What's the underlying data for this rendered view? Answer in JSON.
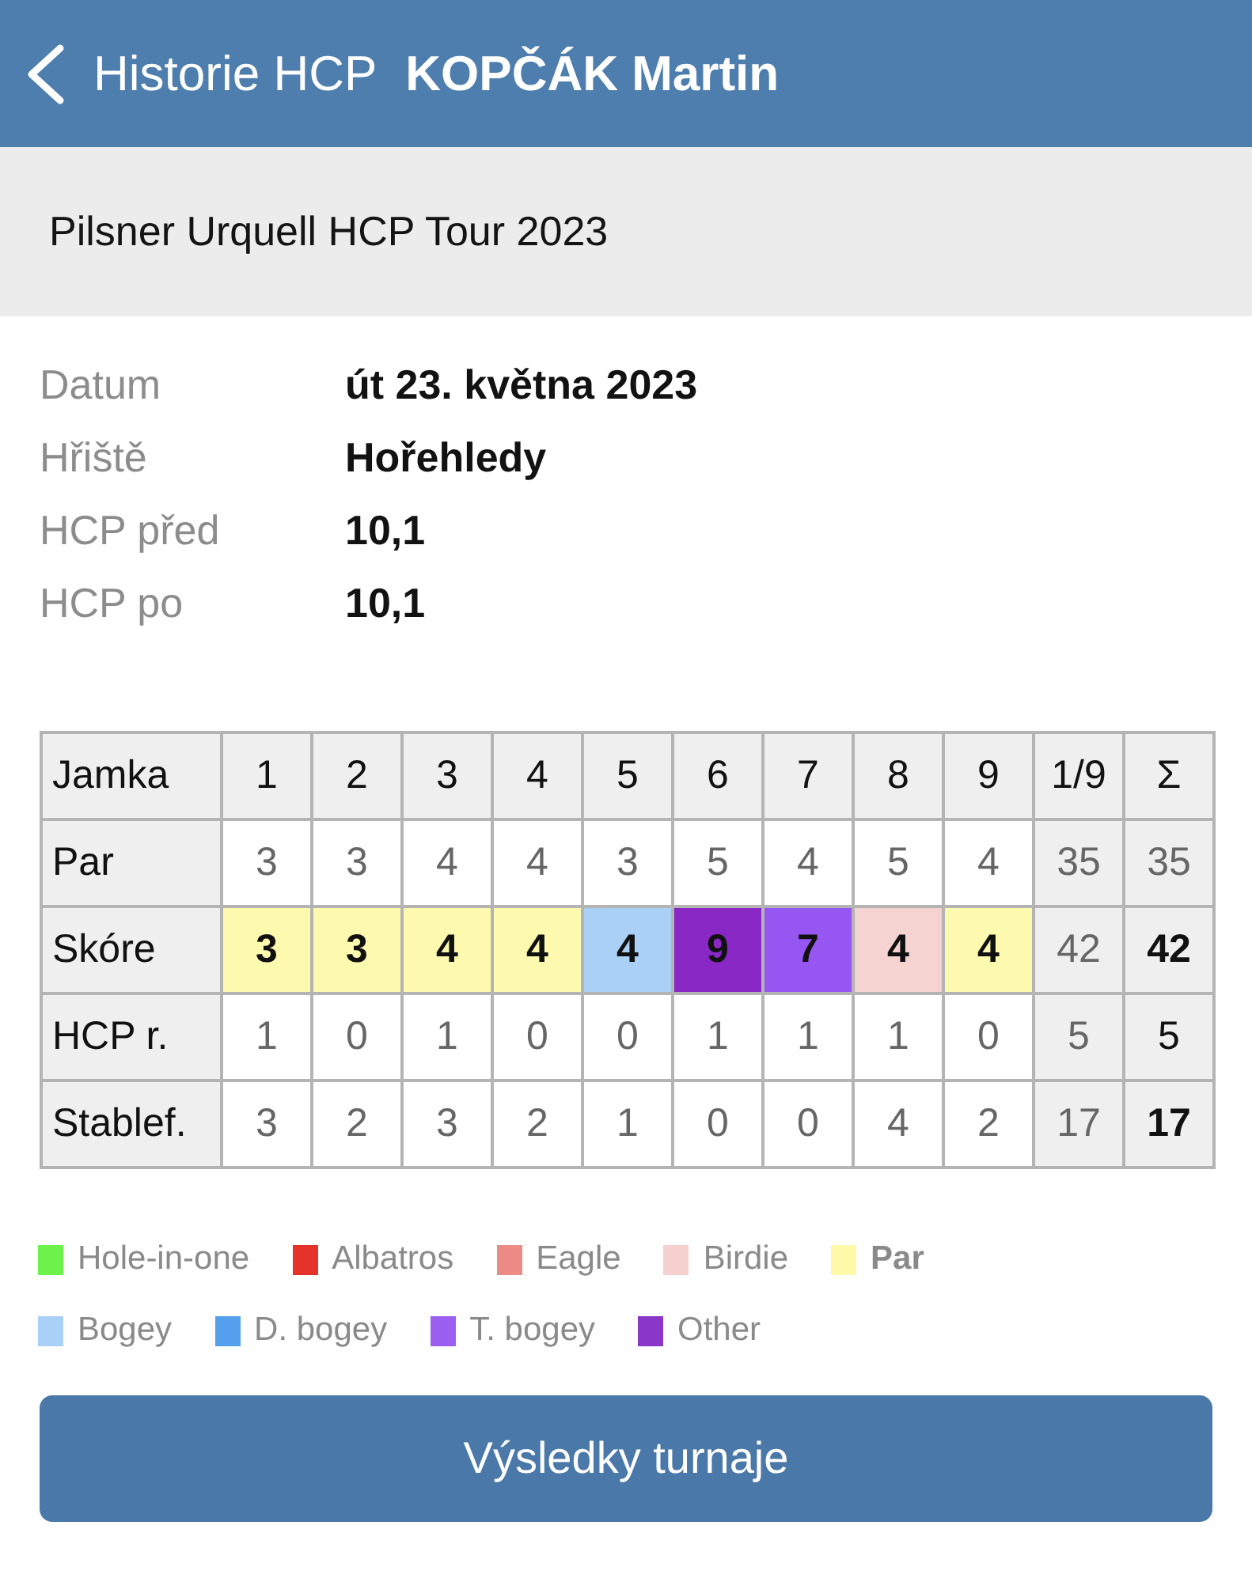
{
  "header": {
    "back_label": "Historie HCP",
    "title": "KOPČÁK Martin"
  },
  "tournament": {
    "name": "Pilsner Urquell HCP Tour 2023"
  },
  "details": [
    {
      "label": "Datum",
      "value": "út 23. května 2023"
    },
    {
      "label": "Hřiště",
      "value": "Hořehledy"
    },
    {
      "label": "HCP před",
      "value": "10,1"
    },
    {
      "label": "HCP po",
      "value": "10,1"
    }
  ],
  "scorecard": {
    "columns": [
      {
        "label": "Jamka",
        "kind": "label"
      },
      {
        "label": "1",
        "kind": "hole"
      },
      {
        "label": "2",
        "kind": "hole"
      },
      {
        "label": "3",
        "kind": "hole"
      },
      {
        "label": "4",
        "kind": "hole"
      },
      {
        "label": "5",
        "kind": "hole"
      },
      {
        "label": "6",
        "kind": "hole"
      },
      {
        "label": "7",
        "kind": "hole"
      },
      {
        "label": "8",
        "kind": "hole"
      },
      {
        "label": "9",
        "kind": "hole"
      },
      {
        "label": "1/9",
        "kind": "total"
      },
      {
        "label": "Σ",
        "kind": "total"
      }
    ],
    "rows": [
      {
        "cells": [
          {
            "text": "Par",
            "bold": false,
            "muted": false
          },
          {
            "text": "3",
            "bold": false,
            "muted": true
          },
          {
            "text": "3",
            "bold": false,
            "muted": true
          },
          {
            "text": "4",
            "bold": false,
            "muted": true
          },
          {
            "text": "4",
            "bold": false,
            "muted": true
          },
          {
            "text": "3",
            "bold": false,
            "muted": true
          },
          {
            "text": "5",
            "bold": false,
            "muted": true
          },
          {
            "text": "4",
            "bold": false,
            "muted": true
          },
          {
            "text": "5",
            "bold": false,
            "muted": true
          },
          {
            "text": "4",
            "bold": false,
            "muted": true
          },
          {
            "text": "35",
            "bold": false,
            "muted": true
          },
          {
            "text": "35",
            "bold": false,
            "muted": true
          }
        ]
      },
      {
        "cells": [
          {
            "text": "Skóre",
            "bold": false,
            "muted": false
          },
          {
            "text": "3",
            "bold": true,
            "muted": false,
            "color": "#fdfab0"
          },
          {
            "text": "3",
            "bold": true,
            "muted": false,
            "color": "#fdfab0"
          },
          {
            "text": "4",
            "bold": true,
            "muted": false,
            "color": "#fdfab0"
          },
          {
            "text": "4",
            "bold": true,
            "muted": false,
            "color": "#fdfab0"
          },
          {
            "text": "4",
            "bold": true,
            "muted": false,
            "color": "#aad0f6"
          },
          {
            "text": "9",
            "bold": true,
            "muted": false,
            "color": "#8a28c6"
          },
          {
            "text": "7",
            "bold": true,
            "muted": false,
            "color": "#9656f2"
          },
          {
            "text": "4",
            "bold": true,
            "muted": false,
            "color": "#f5d3d0"
          },
          {
            "text": "4",
            "bold": true,
            "muted": false,
            "color": "#fdfab0"
          },
          {
            "text": "42",
            "bold": false,
            "muted": true
          },
          {
            "text": "42",
            "bold": true,
            "muted": false
          }
        ]
      },
      {
        "cells": [
          {
            "text": "HCP r.",
            "bold": false,
            "muted": false
          },
          {
            "text": "1",
            "bold": false,
            "muted": true
          },
          {
            "text": "0",
            "bold": false,
            "muted": true
          },
          {
            "text": "1",
            "bold": false,
            "muted": true
          },
          {
            "text": "0",
            "bold": false,
            "muted": true
          },
          {
            "text": "0",
            "bold": false,
            "muted": true
          },
          {
            "text": "1",
            "bold": false,
            "muted": true
          },
          {
            "text": "1",
            "bold": false,
            "muted": true
          },
          {
            "text": "1",
            "bold": false,
            "muted": true
          },
          {
            "text": "0",
            "bold": false,
            "muted": true
          },
          {
            "text": "5",
            "bold": false,
            "muted": true
          },
          {
            "text": "5",
            "bold": false,
            "muted": false
          }
        ]
      },
      {
        "cells": [
          {
            "text": "Stablef.",
            "bold": false,
            "muted": false
          },
          {
            "text": "3",
            "bold": false,
            "muted": true
          },
          {
            "text": "2",
            "bold": false,
            "muted": true
          },
          {
            "text": "3",
            "bold": false,
            "muted": true
          },
          {
            "text": "2",
            "bold": false,
            "muted": true
          },
          {
            "text": "1",
            "bold": false,
            "muted": true
          },
          {
            "text": "0",
            "bold": false,
            "muted": true
          },
          {
            "text": "0",
            "bold": false,
            "muted": true
          },
          {
            "text": "4",
            "bold": false,
            "muted": true
          },
          {
            "text": "2",
            "bold": false,
            "muted": true
          },
          {
            "text": "17",
            "bold": false,
            "muted": true
          },
          {
            "text": "17",
            "bold": true,
            "muted": false
          }
        ]
      }
    ]
  },
  "legend": {
    "rows": [
      [
        {
          "label": "Hole-in-one",
          "color": "#6cf24a",
          "emphasized": false
        },
        {
          "label": "Albatros",
          "color": "#e5332a",
          "emphasized": false
        },
        {
          "label": "Eagle",
          "color": "#ec8a86",
          "emphasized": false
        },
        {
          "label": "Birdie",
          "color": "#f5d0cf",
          "emphasized": false
        },
        {
          "label": "Par",
          "color": "#fdf9a8",
          "emphasized": true
        }
      ],
      [
        {
          "label": "Bogey",
          "color": "#a9d1f7",
          "emphasized": false
        },
        {
          "label": "D. bogey",
          "color": "#55a0ee",
          "emphasized": false
        },
        {
          "label": "T. bogey",
          "color": "#9a5ff0",
          "emphasized": false
        },
        {
          "label": "Other",
          "color": "#8a36c8",
          "emphasized": false
        }
      ]
    ]
  },
  "button": {
    "label": "Výsledky turnaje"
  }
}
